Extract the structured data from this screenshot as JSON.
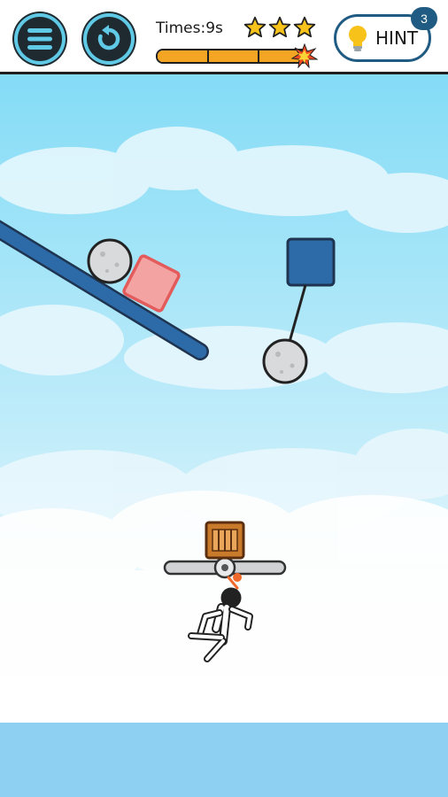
{
  "header": {
    "timer_text": "Times:9s",
    "stars_earned": 3,
    "time_progress": 0.95,
    "hint_label": "HINT",
    "hint_count": "3"
  },
  "icons": {
    "menu": "menu-icon",
    "restart": "restart-icon",
    "hint": "lightbulb-icon",
    "star": "star-icon"
  },
  "colors": {
    "sky": "#8fe0f7",
    "water": "#8ed0f2",
    "ramp": "#2d6aa8",
    "pink_block": "#f4a3a3",
    "blue_block": "#2d6aa8",
    "progress": "#f5a524"
  },
  "scene": {
    "objects": [
      "stone-ball",
      "pink-block",
      "blue-anchor-block",
      "hanging-stone-ball",
      "wooden-crate",
      "rotating-bar",
      "stickman"
    ]
  }
}
